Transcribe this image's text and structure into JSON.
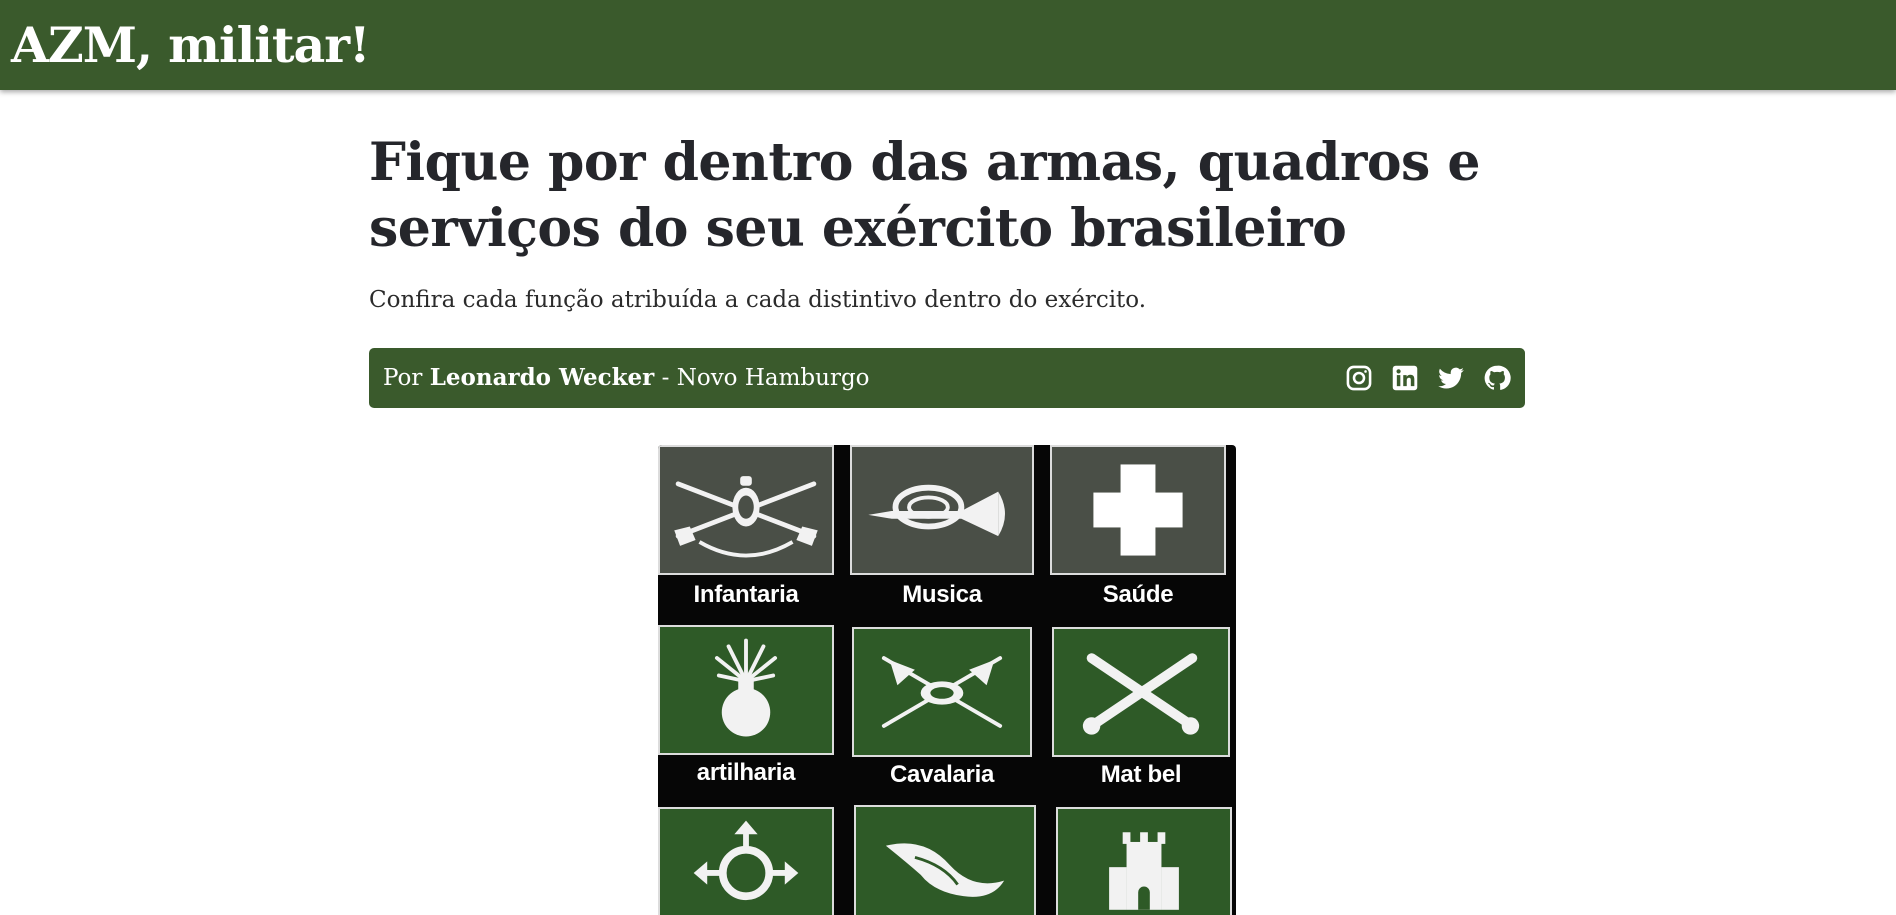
{
  "header": {
    "brand": "AZM, militar!"
  },
  "article": {
    "title": "Fique por dentro das armas, quadros e serviços do seu exército brasileiro",
    "subtitle": "Confira cada função atribuída a cada distintivo dentro do exército.",
    "byline": {
      "prefix": "Por",
      "author": "Leonardo Wecker",
      "separator": "-",
      "location": "Novo Hamburgo"
    },
    "socials": [
      {
        "name": "instagram-icon"
      },
      {
        "name": "linkedin-icon"
      },
      {
        "name": "twitter-icon"
      },
      {
        "name": "github-icon"
      }
    ]
  },
  "badges": [
    {
      "label": "Infantaria",
      "icon": "crossed-rifles-icon"
    },
    {
      "label": "Musica",
      "icon": "bugle-icon"
    },
    {
      "label": "Saúde",
      "icon": "cross-icon"
    },
    {
      "label": "artilharia",
      "icon": "grenade-icon"
    },
    {
      "label": "Cavalaria",
      "icon": "crossed-lances-icon"
    },
    {
      "label": "Mat bel",
      "icon": "crossed-cannons-icon"
    },
    {
      "label": "",
      "icon": "compass-arrows-icon"
    },
    {
      "label": "",
      "icon": "acanthus-leaf-icon"
    },
    {
      "label": "",
      "icon": "castle-tower-icon"
    }
  ],
  "colors": {
    "brand_green": "#3a5a2c",
    "badge_green": "#2e5a27",
    "text": "#212529"
  }
}
